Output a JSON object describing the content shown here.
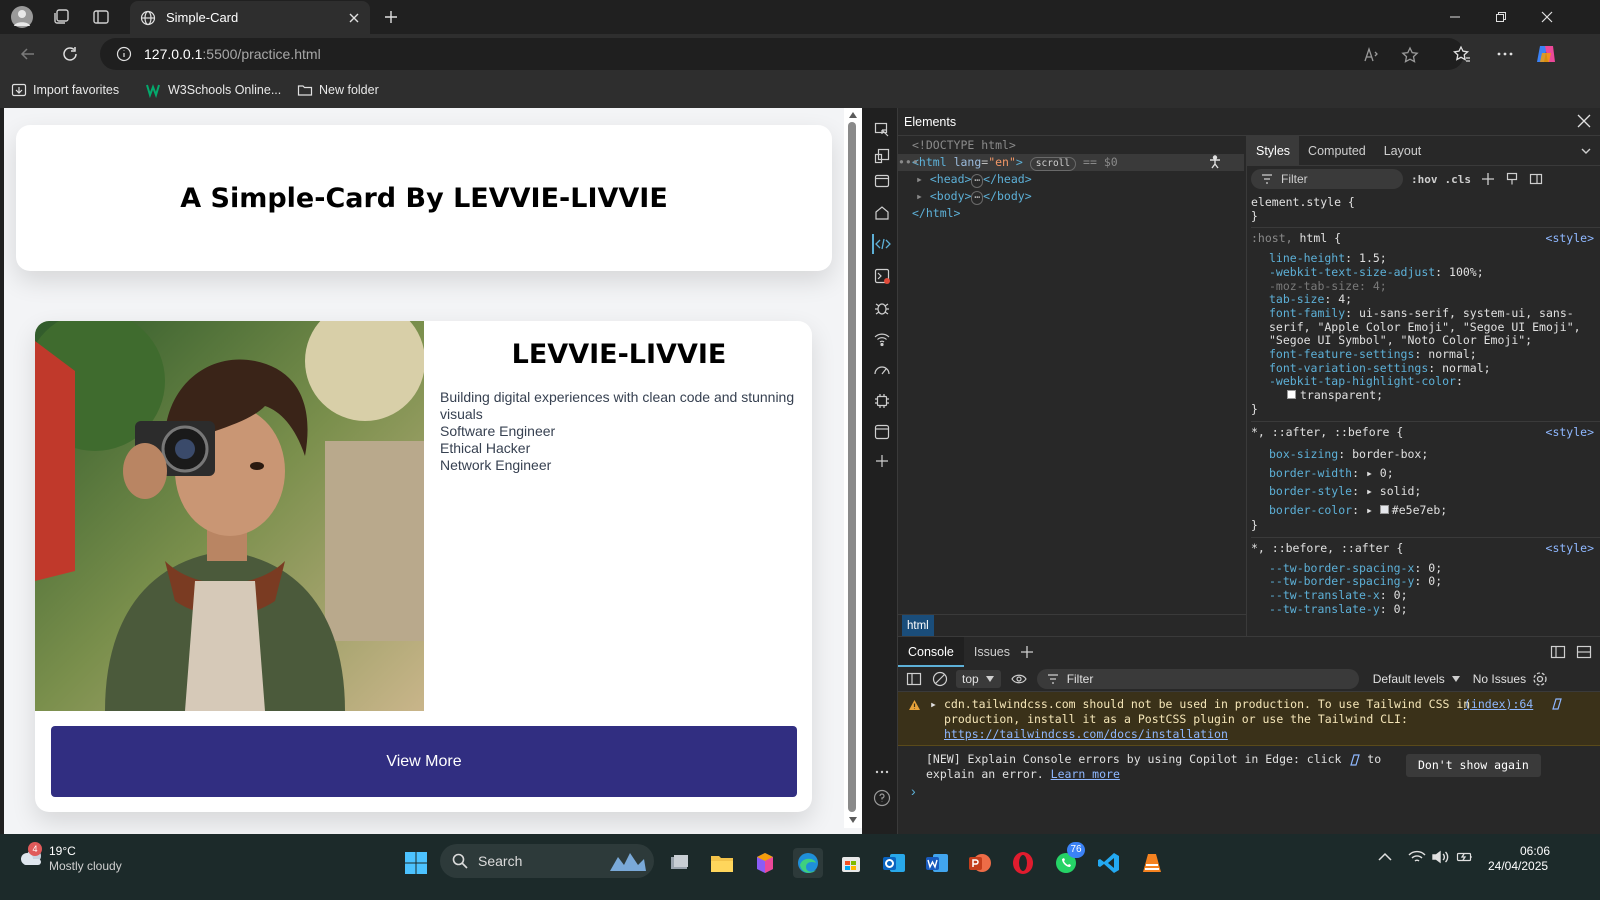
{
  "browser": {
    "tab_title": "Simple-Card",
    "url_host": "127.0.0.1",
    "url_path": ":5500/practice.html",
    "favorites": [
      "Import favorites",
      "W3Schools Online...",
      "New folder"
    ]
  },
  "page": {
    "header_title": "A Simple-Card By LEVVIE-LIVVIE",
    "card": {
      "name": "LEVVIE-LIVVIE",
      "tagline": "Building digital experiences with clean code and stunning visuals",
      "roles": [
        "Software Engineer",
        "Ethical Hacker",
        "Network Engineer"
      ],
      "button_label": "View More"
    }
  },
  "devtools": {
    "panel_title": "Elements",
    "dom": {
      "doctype": "<!DOCTYPE html>",
      "html_open_tag": "<html",
      "html_attr_name": "lang",
      "html_attr_value": "\"en\"",
      "scroll_badge": "scroll",
      "dollar_zero": "== $0",
      "head": "<head>",
      "head_close": "</head>",
      "body": "<body>",
      "body_close": "</body>",
      "html_close": "</html>",
      "breadcrumb": "html"
    },
    "styles_tabs": [
      "Styles",
      "Computed",
      "Layout"
    ],
    "styles_filter": "Filter",
    "hov": ":hov",
    "cls": ".cls",
    "rules": {
      "element_style": "element.style {",
      "close": "}",
      "host_selector": ":host, ",
      "host_selector_b": "html",
      "host_brace": " {",
      "style_src": "<style>",
      "host_props": [
        [
          "line-height",
          "1.5;"
        ],
        [
          "-webkit-text-size-adjust",
          "100%;"
        ],
        [
          "-moz-tab-size",
          "4;"
        ],
        [
          "tab-size",
          "4;"
        ],
        [
          "font-family",
          "ui-sans-serif, system-ui, sans-serif, \"Apple Color Emoji\", \"Segoe UI Emoji\", \"Segoe UI Symbol\", \"Noto Color Emoji\";"
        ],
        [
          "font-feature-settings",
          "normal;"
        ],
        [
          "font-variation-settings",
          "normal;"
        ],
        [
          "-webkit-tap-highlight-color",
          "transparent;"
        ]
      ],
      "sel2": "*, ::after, ::before {",
      "sel2_props": [
        [
          "box-sizing",
          "border-box;"
        ],
        [
          "border-width",
          "0;"
        ],
        [
          "border-style",
          "solid;"
        ],
        [
          "border-color",
          "#e5e7eb;"
        ]
      ],
      "sel3": "*, ::before, ::after {",
      "sel3_props": [
        [
          "--tw-border-spacing-x",
          "0;"
        ],
        [
          "--tw-border-spacing-y",
          "0;"
        ],
        [
          "--tw-translate-x",
          "0;"
        ],
        [
          "--tw-translate-y",
          "0;"
        ]
      ]
    },
    "console": {
      "tabs": [
        "Console",
        "Issues"
      ],
      "context": "top",
      "filter": "Filter",
      "levels": "Default levels",
      "issues": "No Issues",
      "warn_line1": "cdn.tailwindcss.com should not be used in production. To use Tailwind CSS in",
      "warn_line2": "production, install it as a PostCSS plugin or use the Tailwind CLI:",
      "warn_link": "https://tailwindcss.com/docs/installation",
      "warn_source": "(index):64",
      "info_line1": "[NEW] Explain Console errors by using Copilot in Edge: click",
      "info_to": "to",
      "info_line2": "explain an error.",
      "learn_more": "Learn more",
      "dont_show": "Don't show again"
    }
  },
  "taskbar": {
    "weather_temp": "19°C",
    "weather_desc": "Mostly cloudy",
    "weather_badge": "4",
    "search": "Search",
    "whatsapp_badge": "76",
    "time": "06:06",
    "date": "24/04/2025"
  },
  "colors": {
    "button_bg": "#312e81",
    "devtools_link": "#8fb8ff",
    "warning_bg": "#3a3119"
  }
}
